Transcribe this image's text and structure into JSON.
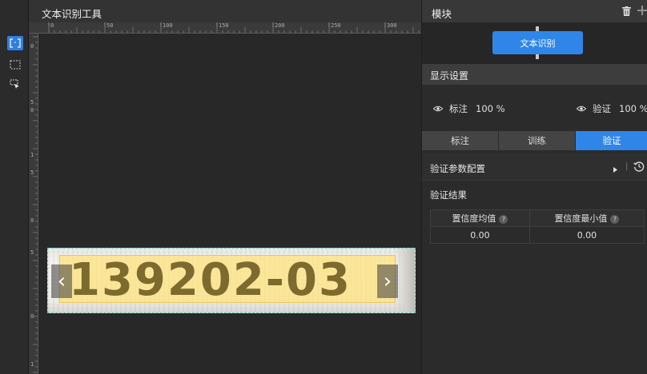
{
  "canvas": {
    "title": "文本识别工具",
    "ruler_top_labels": [
      "0",
      "50",
      "100",
      "150",
      "200",
      "250",
      "300"
    ],
    "ruler_left_labels": [
      "0",
      "5",
      "0",
      "1",
      "5",
      "0",
      "5",
      "0",
      "1"
    ],
    "ocr_text": "139202-03",
    "prev_arrow": "‹",
    "next_arrow": "›"
  },
  "tools": [
    {
      "name": "rect-select-tool",
      "active": true
    },
    {
      "name": "region-select-tool",
      "active": false
    },
    {
      "name": "image-crop-tool",
      "active": false
    }
  ],
  "panel": {
    "module_title": "模块",
    "module_node": "文本识别",
    "display_settings": "显示设置",
    "annotation_label": "标注",
    "annotation_opacity": "100 %",
    "verify_label": "验证",
    "verify_opacity": "100 %",
    "tabs": [
      "标注",
      "训练",
      "验证"
    ],
    "active_tab": "验证",
    "verify_config": "验证参数配置",
    "verify_result": "验证结果",
    "table": {
      "headers": [
        "置信度均值",
        "置信度最小值"
      ],
      "help": "?",
      "rows": [
        [
          "0.00",
          "0.00"
        ]
      ]
    }
  },
  "colors": {
    "accent": "#2f86e8",
    "background": "#2b2b2b",
    "highlight": "#ffe278"
  }
}
